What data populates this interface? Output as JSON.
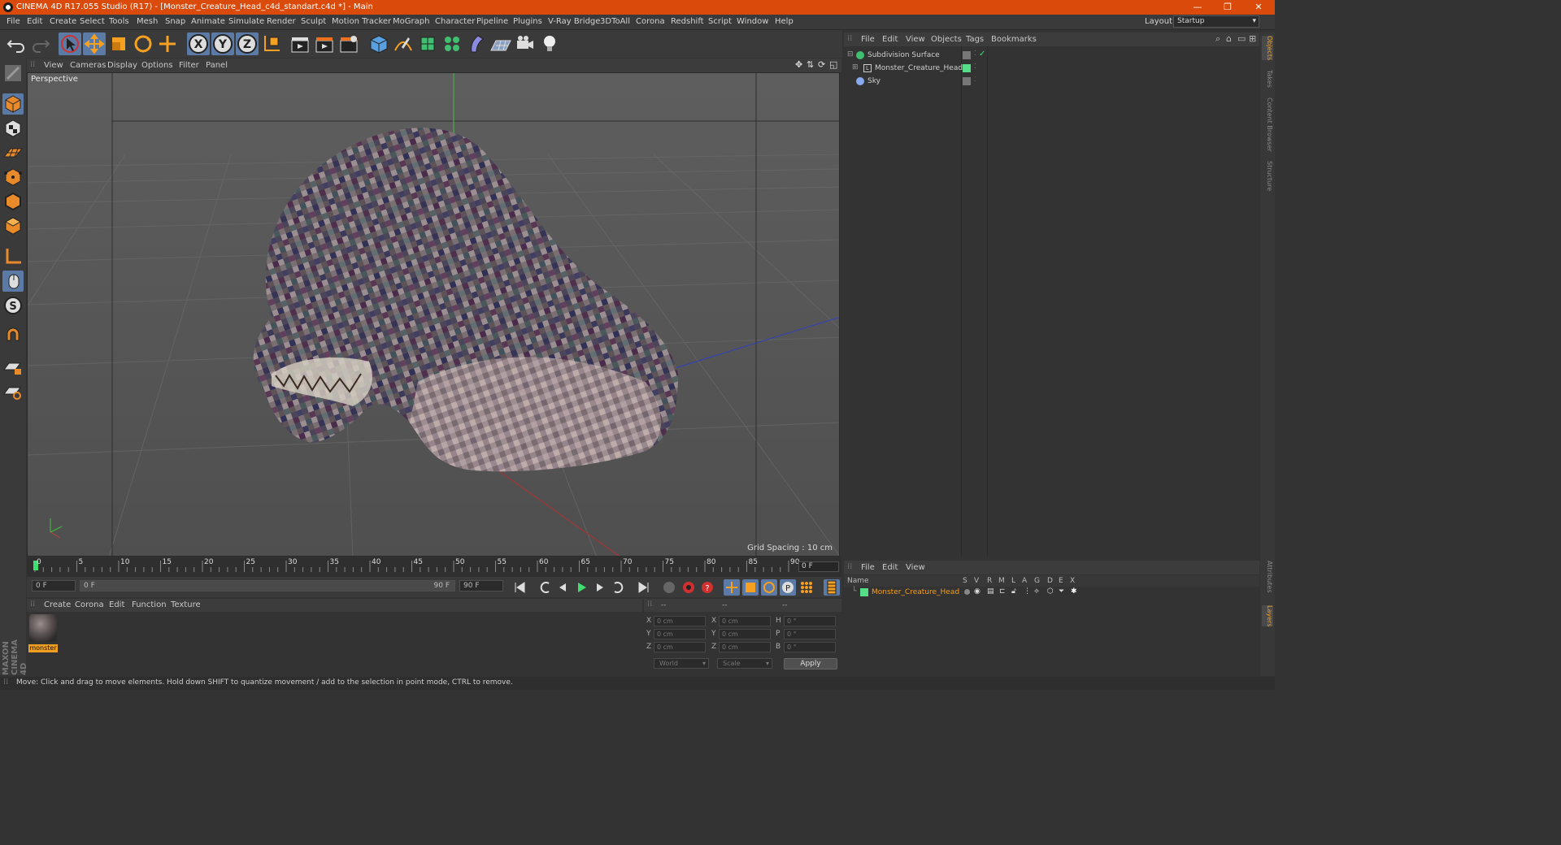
{
  "window": {
    "title": "CINEMA 4D R17.055 Studio (R17) - [Monster_Creature_Head_c4d_standart.c4d *] - Main",
    "controls": [
      "—",
      "❐",
      "✕"
    ]
  },
  "menubar": {
    "items": [
      "File",
      "Edit",
      "Create",
      "Select",
      "Tools",
      "Mesh",
      "Snap",
      "Animate",
      "Simulate",
      "Render",
      "Sculpt",
      "Motion Tracker",
      "MoGraph",
      "Character",
      "Pipeline",
      "Plugins",
      "V-Ray Bridge",
      "3DToAll",
      "Corona",
      "Redshift",
      "Script",
      "Window",
      "Help"
    ],
    "layout_label": "Layout:",
    "layout_value": "Startup"
  },
  "viewport": {
    "menu": [
      "View",
      "Cameras",
      "Display",
      "Options",
      "Filter",
      "Panel"
    ],
    "label": "Perspective",
    "grid_spacing": "Grid Spacing : 10 cm"
  },
  "timeline": {
    "ticks": [
      "0",
      "5",
      "10",
      "15",
      "20",
      "25",
      "30",
      "35",
      "40",
      "45",
      "50",
      "55",
      "60",
      "65",
      "70",
      "75",
      "80",
      "85",
      "90"
    ],
    "current_frame": "0 F",
    "start_field": "0 F",
    "range_start": "0 F",
    "range_end": "90 F",
    "end_field": "90 F"
  },
  "material_manager": {
    "menu": [
      "Create",
      "Corona",
      "Edit",
      "Function",
      "Texture"
    ],
    "materials": [
      {
        "name": "monster"
      }
    ]
  },
  "coordinates": {
    "headers": [
      "--",
      "--",
      "--"
    ],
    "rows": [
      {
        "a": "X",
        "av": "0 cm",
        "b": "X",
        "bv": "0 cm",
        "c": "H",
        "cv": "0 °"
      },
      {
        "a": "Y",
        "av": "0 cm",
        "b": "Y",
        "bv": "0 cm",
        "c": "P",
        "cv": "0 °"
      },
      {
        "a": "Z",
        "av": "0 cm",
        "b": "Z",
        "bv": "0 cm",
        "c": "B",
        "cv": "0 °"
      }
    ],
    "mode1": "World",
    "mode2": "Scale",
    "apply": "Apply"
  },
  "status": {
    "text": "Move: Click and drag to move elements. Hold down SHIFT to quantize movement / add to the selection in point mode, CTRL to remove."
  },
  "object_manager": {
    "menu": [
      "File",
      "Edit",
      "View",
      "Objects",
      "Tags",
      "Bookmarks"
    ],
    "objects": [
      {
        "name": "Subdivision Surface"
      },
      {
        "name": "Monster_Creature_Head"
      },
      {
        "name": "Sky"
      }
    ]
  },
  "layer_manager": {
    "menu": [
      "File",
      "Edit",
      "View"
    ],
    "columns": [
      "Name",
      "S",
      "V",
      "R",
      "M",
      "L",
      "A",
      "G",
      "D",
      "E",
      "X"
    ],
    "layers": [
      {
        "name": "Monster_Creature_Head"
      }
    ]
  },
  "side_tabs": [
    "Objects",
    "Takes",
    "Content Browser",
    "Structure",
    "Attributes",
    "Layers"
  ],
  "branding": {
    "text1": "MAXON",
    "text2": "CINEMA 4D"
  },
  "colors": {
    "title_bar": "#d94a0b",
    "selection": "#5b7aa5",
    "material_tag": "#f0a020",
    "layer_color": "#55dd88"
  }
}
